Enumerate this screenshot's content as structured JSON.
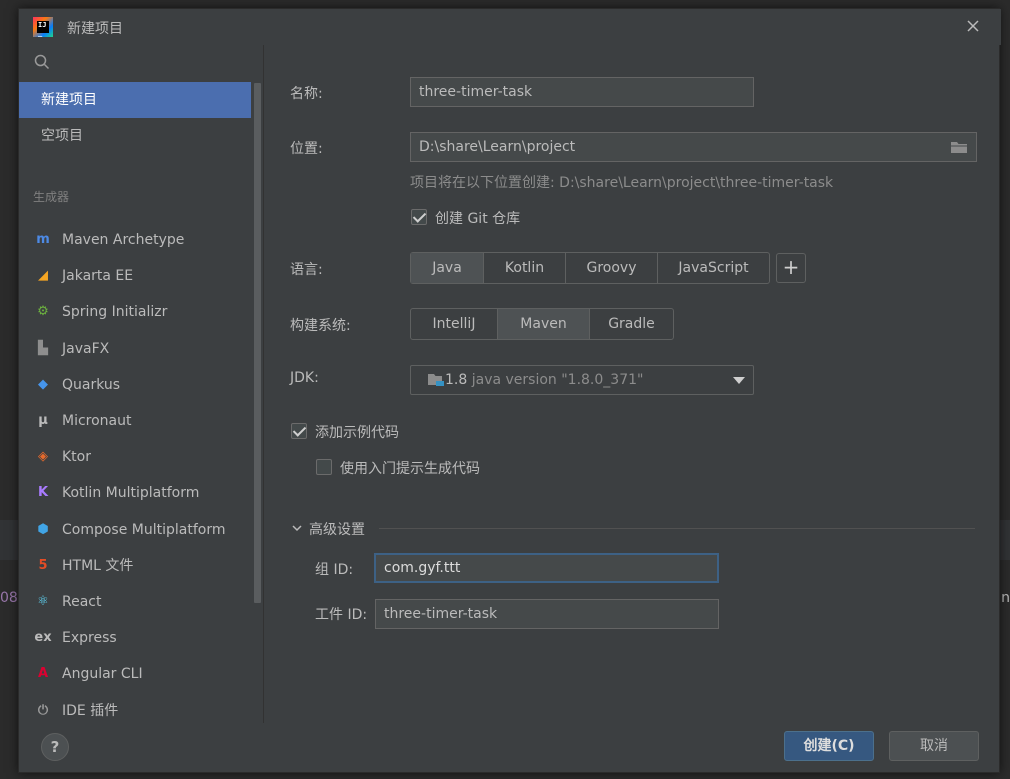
{
  "window": {
    "title": "新建项目"
  },
  "sidebar": {
    "items": [
      {
        "label": "新建项目",
        "selected": true
      },
      {
        "label": "空项目",
        "selected": false
      }
    ],
    "section_label": "生成器",
    "generators": [
      {
        "label": "Maven Archetype",
        "icon": "maven-icon",
        "glyph": "m",
        "color": "#4d8ae5"
      },
      {
        "label": "Jakarta EE",
        "icon": "jakarta-icon",
        "glyph": "◢",
        "color": "#f5a623"
      },
      {
        "label": "Spring Initializr",
        "icon": "spring-icon",
        "glyph": "⚙",
        "color": "#6db33f"
      },
      {
        "label": "JavaFX",
        "icon": "javafx-icon",
        "glyph": "▙",
        "color": "#8e8e8e"
      },
      {
        "label": "Quarkus",
        "icon": "quarkus-icon",
        "glyph": "◆",
        "color": "#4695eb"
      },
      {
        "label": "Micronaut",
        "icon": "micronaut-icon",
        "glyph": "μ",
        "color": "#bbbbbb"
      },
      {
        "label": "Ktor",
        "icon": "ktor-icon",
        "glyph": "◈",
        "color": "#e66a2c"
      },
      {
        "label": "Kotlin Multiplatform",
        "icon": "kotlin-icon",
        "glyph": "K",
        "color": "#a97bff"
      },
      {
        "label": "Compose Multiplatform",
        "icon": "compose-icon",
        "glyph": "⬢",
        "color": "#41a5e6"
      },
      {
        "label": "HTML 文件",
        "icon": "html5-icon",
        "glyph": "5",
        "color": "#e44d26"
      },
      {
        "label": "React",
        "icon": "react-icon",
        "glyph": "⚛",
        "color": "#61dafb"
      },
      {
        "label": "Express",
        "icon": "express-icon",
        "glyph": "ex",
        "color": "#bbbbbb"
      },
      {
        "label": "Angular CLI",
        "icon": "angular-icon",
        "glyph": "A",
        "color": "#dd0031"
      },
      {
        "label": "IDE 插件",
        "icon": "plugin-icon",
        "glyph": "⏻",
        "color": "#9a9a9a"
      }
    ]
  },
  "form": {
    "name_label": "名称:",
    "name_value": "three-timer-task",
    "location_label": "位置:",
    "location_value": "D:\\share\\Learn\\project",
    "location_hint": "项目将在以下位置创建: D:\\share\\Learn\\project\\three-timer-task",
    "git_checkbox_label": "创建 Git 仓库",
    "git_checked": true,
    "language_label": "语言:",
    "languages": [
      "Java",
      "Kotlin",
      "Groovy",
      "JavaScript"
    ],
    "language_selected": "Java",
    "add_language": "+",
    "build_label": "构建系统:",
    "build_systems": [
      "IntelliJ",
      "Maven",
      "Gradle"
    ],
    "build_selected": "Maven",
    "jdk_label": "JDK:",
    "jdk_version": "1.8",
    "jdk_detail": "java version \"1.8.0_371\"",
    "sample_code_label": "添加示例代码",
    "sample_code_checked": true,
    "onboarding_label": "使用入门提示生成代码",
    "onboarding_checked": false,
    "advanced_label": "高级设置",
    "group_id_label": "组 ID:",
    "group_id_value": "com.gyf.ttt",
    "artifact_id_label": "工件 ID:",
    "artifact_id_value": "three-timer-task"
  },
  "buttons": {
    "help": "?",
    "create": "创建(C)",
    "cancel": "取消"
  },
  "background": {
    "left_fragment": "08",
    "right_fragment": "n"
  },
  "colors": {
    "selection": "#4b6eaf",
    "primary_button": "#365880",
    "dialog_bg": "#3c3f41"
  }
}
